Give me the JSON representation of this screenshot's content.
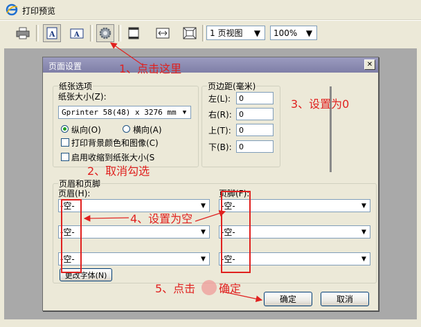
{
  "window": {
    "title": "打印预览"
  },
  "toolbar": {
    "view_select": "1 页视图",
    "zoom_select": "100%"
  },
  "dialog": {
    "title": "页面设置",
    "close_glyph": "✕",
    "paper": {
      "legend": "纸张选项",
      "size_label": "纸张大小(Z):",
      "size_value": "Gprinter 58(48) x 3276 mm",
      "portrait_label": "纵向(O)",
      "landscape_label": "横向(A)",
      "print_bg_label": "打印背景颜色和图像(C)",
      "shrink_label": "启用收缩到纸张大小(S"
    },
    "margins": {
      "legend": "页边距(毫米)",
      "left_label": "左(L):",
      "left_value": "0",
      "right_label": "右(R):",
      "right_value": "0",
      "top_label": "上(T):",
      "top_value": "0",
      "bottom_label": "下(B):",
      "bottom_value": "0"
    },
    "header_footer": {
      "legend": "页眉和页脚",
      "header_label": "页眉(H):",
      "footer_label": "页脚(F):",
      "header_values": [
        "-空-",
        "-空-",
        "-空-"
      ],
      "footer_values": [
        "-空-",
        "-空-",
        "-空-"
      ],
      "font_button": "更改字体(N)"
    },
    "ok_button": "确定",
    "cancel_button": "取消"
  },
  "annotations": {
    "step1": "1、点击这里",
    "step2": "2、取消勾选",
    "step3": "3、设置为0",
    "step4": "4、设置为空",
    "step5": "5、点击",
    "step5_tail": "确定"
  },
  "colors": {
    "annotation_red": "#e0211f",
    "title_bar": "#8585ad"
  }
}
